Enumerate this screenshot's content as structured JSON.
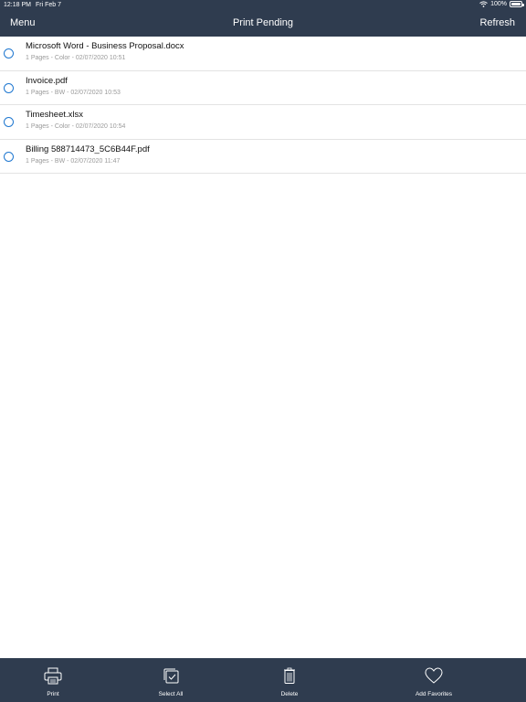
{
  "status_bar": {
    "time": "12:18 PM",
    "date": "Fri Feb 7",
    "battery": "100%"
  },
  "nav": {
    "left": "Menu",
    "title": "Print Pending",
    "right": "Refresh"
  },
  "jobs": [
    {
      "title": "Microsoft Word - Business Proposal.docx",
      "meta": "1 Pages - Color - 02/07/2020 10:51"
    },
    {
      "title": "Invoice.pdf",
      "meta": "1 Pages - BW - 02/07/2020 10:53"
    },
    {
      "title": "Timesheet.xlsx",
      "meta": "1 Pages - Color - 02/07/2020 10:54"
    },
    {
      "title": "Billing 588714473_5C6B44F.pdf",
      "meta": "1 Pages - BW - 02/07/2020 11:47"
    }
  ],
  "toolbar": {
    "print": "Print",
    "select_all": "Select All",
    "delete": "Delete",
    "add_favorites": "Add Favorites"
  },
  "colors": {
    "bar_background": "#2f3c4f",
    "radio_accent": "#1f77d0"
  }
}
